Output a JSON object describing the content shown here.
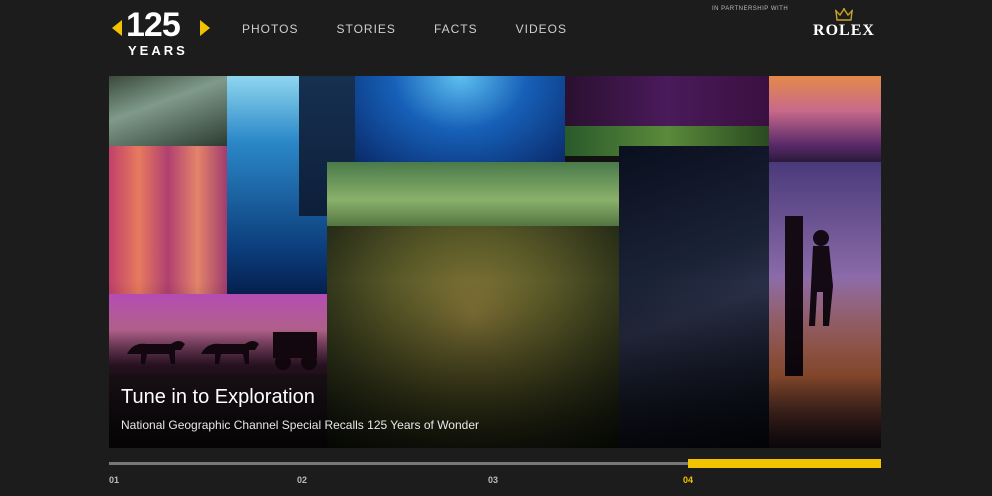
{
  "logo": {
    "number": "125",
    "subtitle": "YEARS"
  },
  "nav": {
    "items": [
      "PHOTOS",
      "STORIES",
      "FACTS",
      "VIDEOS"
    ]
  },
  "partner": {
    "text": "IN PARTNERSHIP WITH",
    "brand": "ROLEX"
  },
  "hero": {
    "title": "Tune in to Exploration",
    "subtitle": "National Geographic Channel Special Recalls 125 Years of Wonder"
  },
  "slider": {
    "labels": [
      "01",
      "02",
      "03",
      "04"
    ],
    "active_index": 3
  },
  "colors": {
    "accent": "#f2c200",
    "background": "#1c1c1c",
    "track": "#777777"
  },
  "icons": {
    "crown": "crown-icon",
    "arrows": "chevron-left-icon / chevron-right-icon"
  }
}
